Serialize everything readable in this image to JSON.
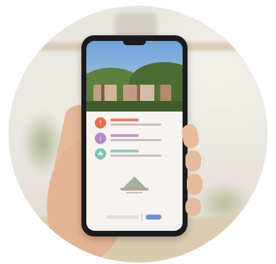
{
  "app": {
    "hero_image": "mountain-village-photo",
    "colors": {
      "item1": "#e36f4c",
      "item2": "#b58ac7",
      "item3": "#7fc1b3",
      "accent_button": "#6f8fd6"
    },
    "menu": [
      {
        "icon": "alert-icon",
        "title": "",
        "description": ""
      },
      {
        "icon": "info-icon",
        "title": "",
        "description": ""
      },
      {
        "icon": "leaf-icon",
        "title": "",
        "description": ""
      }
    ],
    "footer": {
      "logo": "mountain-logo",
      "input_value": "",
      "button_label": ""
    }
  }
}
